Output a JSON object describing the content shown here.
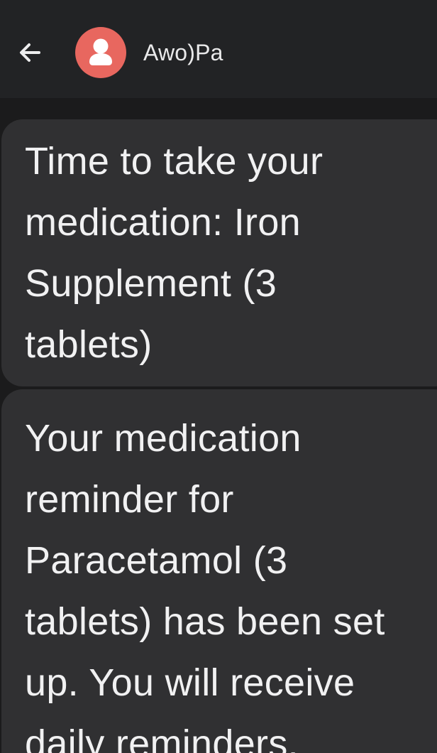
{
  "header": {
    "back_icon": "arrow-back-icon",
    "avatar_icon": "person-icon",
    "avatar_color": "#e8675f",
    "contact_name": "Awo)Pa"
  },
  "messages": [
    {
      "text": "Time to take your\nmedication: Iron\nSupplement (3\ntablets)"
    },
    {
      "text": "Your medication\nreminder for\nParacetamol (3\ntablets) has been set\nup. You will receive\ndaily reminders."
    }
  ]
}
